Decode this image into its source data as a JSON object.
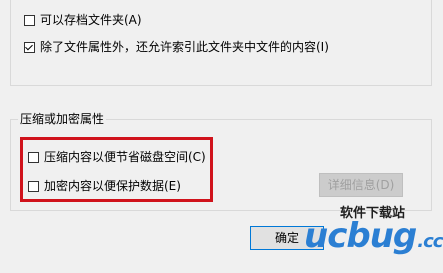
{
  "archive_group": {
    "archive_label": "可以存档文件夹(A)",
    "archive_checked": false,
    "index_label": "除了文件属性外，还允许索引此文件夹中文件的内容(I)",
    "index_checked": true
  },
  "compress_group": {
    "title": "压缩或加密属性",
    "compress_label": "压缩内容以便节省磁盘空间(C)",
    "compress_checked": false,
    "encrypt_label": "加密内容以便保护数据(E)",
    "encrypt_checked": false,
    "details_button": "详细信息(D)"
  },
  "buttons": {
    "ok_partial": "确定"
  },
  "watermark": {
    "site_name": "软件下载站",
    "logo": "ucbug",
    "logo_suffix": ".cc"
  },
  "colors": {
    "highlight": "#d0121b",
    "background": "#f0f0f0"
  }
}
